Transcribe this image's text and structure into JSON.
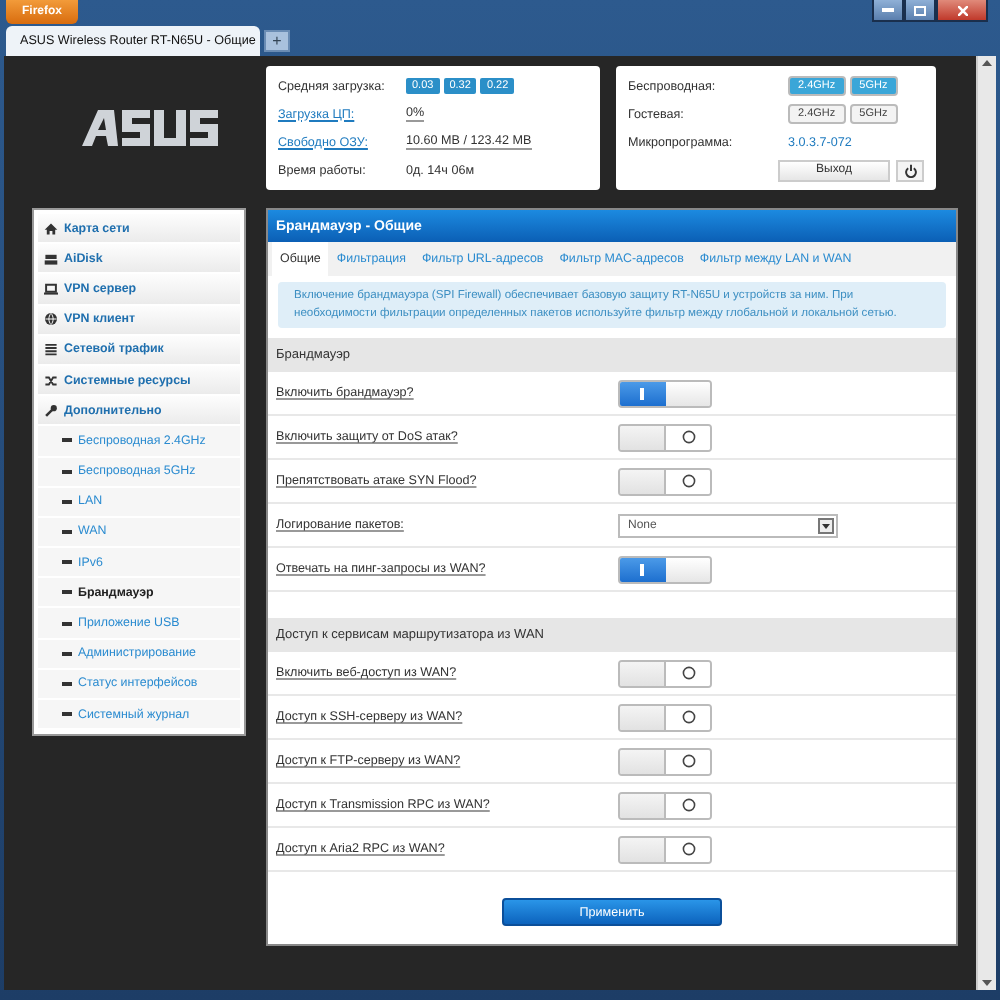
{
  "browser": {
    "menu_button": "Firefox",
    "tab_title": "ASUS Wireless Router RT-N65U - Общие",
    "new_tab": "+"
  },
  "status": {
    "left": [
      {
        "label": "Средняя загрузка:",
        "link": false,
        "kind": "badges",
        "badges": [
          "0.03",
          "0.32",
          "0.22"
        ]
      },
      {
        "label": "Загрузка ЦП:",
        "link": true,
        "kind": "text",
        "value": "0%"
      },
      {
        "label": "Свободно ОЗУ:",
        "link": true,
        "kind": "text",
        "value": "10.60 MB / 123.42 MB"
      },
      {
        "label": "Время работы:",
        "link": false,
        "kind": "text",
        "value": "0д. 14ч 06м"
      }
    ],
    "right": [
      {
        "label": "Беспроводная:",
        "kind": "bands",
        "bands": [
          {
            "label": "2.4GHz",
            "on": true
          },
          {
            "label": "5GHz",
            "on": true
          }
        ]
      },
      {
        "label": "Гостевая:",
        "kind": "bands",
        "bands": [
          {
            "label": "2.4GHz",
            "on": false
          },
          {
            "label": "5GHz",
            "on": false
          }
        ]
      },
      {
        "label": "Микропрограмма:",
        "kind": "link",
        "value": "3.0.3.7-072"
      },
      {
        "kind": "logout",
        "value": "Выход"
      }
    ]
  },
  "sidebar": {
    "items": [
      {
        "label": "Карта сети",
        "selected": false
      },
      {
        "label": "AiDisk",
        "selected": false
      },
      {
        "label": "VPN сервер",
        "selected": false
      },
      {
        "label": "VPN клиент",
        "selected": false
      },
      {
        "label": "Сетевой трафик",
        "selected": false
      },
      {
        "label": "Системные ресурсы",
        "selected": false
      },
      {
        "label": "Дополнительно",
        "selected": false,
        "children": [
          {
            "label": "Беспроводная 2.4GHz",
            "selected": false
          },
          {
            "label": "Беспроводная 5GHz",
            "selected": false
          },
          {
            "label": "LAN",
            "selected": false
          },
          {
            "label": "WAN",
            "selected": false
          },
          {
            "label": "IPv6",
            "selected": false
          },
          {
            "label": "Брандмауэр",
            "selected": true
          },
          {
            "label": "Приложение USB",
            "selected": false
          },
          {
            "label": "Администрирование",
            "selected": false
          },
          {
            "label": "Статус интерфейсов",
            "selected": false
          },
          {
            "label": "Системный журнал",
            "selected": false
          }
        ]
      }
    ]
  },
  "panel": {
    "title": "Брандмауэр - Общие",
    "tabs": [
      {
        "label": "Общие",
        "selected": true
      },
      {
        "label": "Фильтрация",
        "selected": false
      },
      {
        "label": "Фильтр URL-адресов",
        "selected": false
      },
      {
        "label": "Фильтр MAC-адресов",
        "selected": false
      },
      {
        "label": "Фильтр между LAN и WAN",
        "selected": false
      }
    ],
    "info": "Включение брандмауэра (SPI Firewall) обеспечивает базовую защиту RT-N65U и устройств за ним. При необходимости фильтрации определенных пакетов используйте фильтр между глобальной и локальной сетью.",
    "sections": [
      {
        "title": "Брандмауэр",
        "rows": [
          {
            "label": "Включить брандмауэр?",
            "kind": "toggle",
            "on": true
          },
          {
            "label": "Включить защиту от DoS атак?",
            "kind": "toggle",
            "on": false
          },
          {
            "label": "Препятствовать атаке SYN Flood?",
            "kind": "toggle",
            "on": false
          },
          {
            "label": "Логирование пакетов:",
            "kind": "select",
            "value": "None"
          },
          {
            "label": "Отвечать на пинг-запросы из WAN?",
            "kind": "toggle",
            "on": true
          }
        ]
      },
      {
        "title": "Доступ к сервисам маршрутизатора из WAN",
        "rows": [
          {
            "label": "Включить веб-доступ из WAN?",
            "kind": "toggle",
            "on": false
          },
          {
            "label": "Доступ к SSH-серверу из WAN?",
            "kind": "toggle",
            "on": false
          },
          {
            "label": "Доступ к FTP-серверу из WAN?",
            "kind": "toggle",
            "on": false
          },
          {
            "label": "Доступ к Transmission RPC из WAN?",
            "kind": "toggle",
            "on": false
          },
          {
            "label": "Доступ к Aria2 RPC из WAN?",
            "kind": "toggle",
            "on": false
          }
        ]
      }
    ],
    "apply": "Применить"
  }
}
